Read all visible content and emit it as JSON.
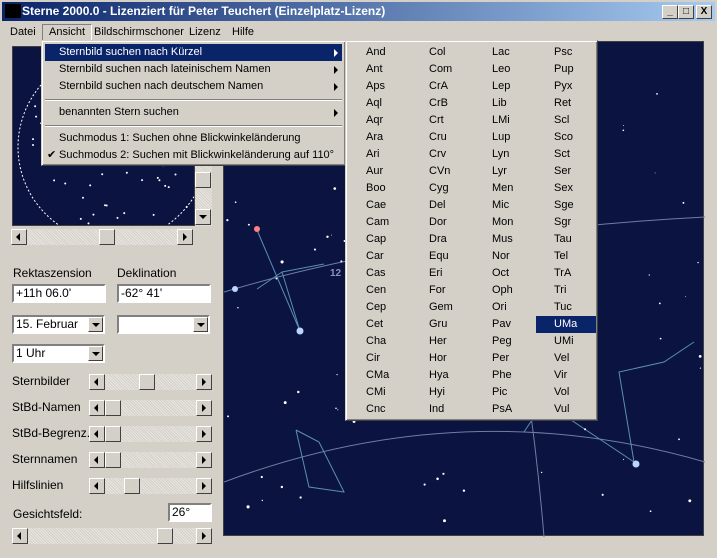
{
  "window": {
    "title": "Sterne 2000.0 - Lizenziert für Peter Teuchert (Einzelplatz-Lizenz)",
    "minimize": "_",
    "maximize": "□",
    "close": "X"
  },
  "menubar": [
    "Datei",
    "Ansicht",
    "Bildschirmschoner",
    "Lizenz",
    "Hilfe"
  ],
  "ansicht_menu": {
    "items": [
      {
        "label": "Sternbild suchen nach Kürzel",
        "submenu": true,
        "highlighted": true
      },
      {
        "label": "Sternbild suchen nach lateinischem Namen",
        "submenu": true
      },
      {
        "label": "Sternbild suchen nach deutschem Namen",
        "submenu": true
      },
      {
        "label": "benannten Stern suchen",
        "submenu": true
      },
      {
        "label": "Suchmodus 1: Suchen ohne Blickwinkeländerung",
        "checked": false
      },
      {
        "label": "Suchmodus 2: Suchen mit Blickwinkeländerung auf 110°",
        "checked": true
      }
    ],
    "check_mark": "✔"
  },
  "abbrev_submenu": {
    "columns": [
      [
        "And",
        "Ant",
        "Aps",
        "Aql",
        "Aqr",
        "Ara",
        "Ari",
        "Aur",
        "Boo",
        "Cae",
        "Cam",
        "Cap",
        "Car",
        "Cas",
        "Cen",
        "Cep",
        "Cet",
        "Cha",
        "Cir",
        "CMa",
        "CMi",
        "Cnc"
      ],
      [
        "Col",
        "Com",
        "CrA",
        "CrB",
        "Crt",
        "Cru",
        "Crv",
        "CVn",
        "Cyg",
        "Del",
        "Dor",
        "Dra",
        "Equ",
        "Eri",
        "For",
        "Gem",
        "Gru",
        "Her",
        "Hor",
        "Hya",
        "Hyi",
        "Ind"
      ],
      [
        "Lac",
        "Leo",
        "Lep",
        "Lib",
        "LMi",
        "Lup",
        "Lyn",
        "Lyr",
        "Men",
        "Mic",
        "Mon",
        "Mus",
        "Nor",
        "Oct",
        "Oph",
        "Ori",
        "Pav",
        "Peg",
        "Per",
        "Phe",
        "Pic",
        "PsA"
      ],
      [
        "Psc",
        "Pup",
        "Pyx",
        "Ret",
        "Scl",
        "Sco",
        "Sct",
        "Ser",
        "Sex",
        "Sge",
        "Sgr",
        "Tau",
        "Tel",
        "TrA",
        "Tri",
        "Tuc",
        "UMa",
        "UMi",
        "Vel",
        "Vir",
        "Vol",
        "Vul"
      ]
    ],
    "highlighted": "UMa"
  },
  "panel": {
    "ra_label": "Rektaszension",
    "ra_value": "+11h 06.0'",
    "dec_label": "Deklination",
    "dec_value": "-62° 41'",
    "date": "15. Februar",
    "date2": "",
    "time": "1 Uhr",
    "sliders": [
      {
        "label": "Sternbilder",
        "value": 0.45
      },
      {
        "label": "StBd-Namen",
        "value": 0
      },
      {
        "label": "StBd-Begrenz.",
        "value": 0
      },
      {
        "label": "Sternnamen",
        "value": 0
      },
      {
        "label": "Hilfslinien",
        "value": 0.25
      }
    ],
    "fov_label": "Gesichtsfeld:",
    "fov_value": "26°",
    "fov_slider": 0.85
  },
  "sky": {
    "label": "12",
    "background": "#0b1340",
    "line_color": "#5a8fb0"
  },
  "colors": {
    "highlight": "#0a246a",
    "face": "#d4d0c8"
  }
}
